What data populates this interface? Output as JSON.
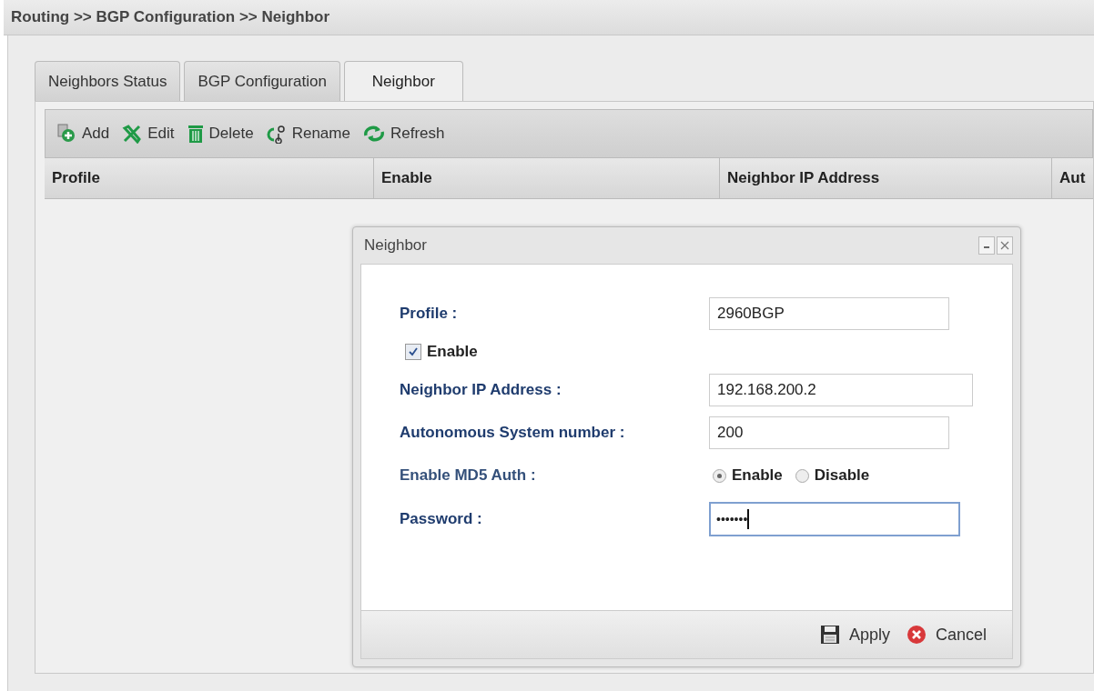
{
  "breadcrumb": "Routing >> BGP Configuration >> Neighbor",
  "tabs": [
    {
      "label": "Neighbors Status",
      "selected": false
    },
    {
      "label": "BGP Configuration",
      "selected": false
    },
    {
      "label": "Neighbor",
      "selected": true
    }
  ],
  "toolbar": [
    {
      "label": "Add",
      "kind": "add"
    },
    {
      "label": "Edit",
      "kind": "edit"
    },
    {
      "label": "Delete",
      "kind": "delete"
    },
    {
      "label": "Rename",
      "kind": "rename"
    },
    {
      "label": "Refresh",
      "kind": "refresh"
    }
  ],
  "table": {
    "columns": [
      "Profile",
      "Enable",
      "Neighbor IP Address",
      "Aut"
    ]
  },
  "dialog": {
    "title": "Neighbor",
    "profile": {
      "label": "Profile :",
      "value": "2960BGP"
    },
    "enable": {
      "label": "Enable",
      "checked": true
    },
    "neighbor_ip": {
      "label": "Neighbor IP Address :",
      "value": "192.168.200.2"
    },
    "as_number": {
      "label": "Autonomous System number :",
      "value": "200"
    },
    "md5_auth": {
      "label": "Enable MD5 Auth :",
      "options": [
        {
          "label": "Enable",
          "selected": true
        },
        {
          "label": "Disable",
          "selected": false
        }
      ]
    },
    "password": {
      "label": "Password :",
      "value": "•••••••",
      "focused": true
    },
    "buttons": [
      {
        "label": "Apply",
        "kind": "apply"
      },
      {
        "label": "Cancel",
        "kind": "cancel"
      }
    ]
  }
}
